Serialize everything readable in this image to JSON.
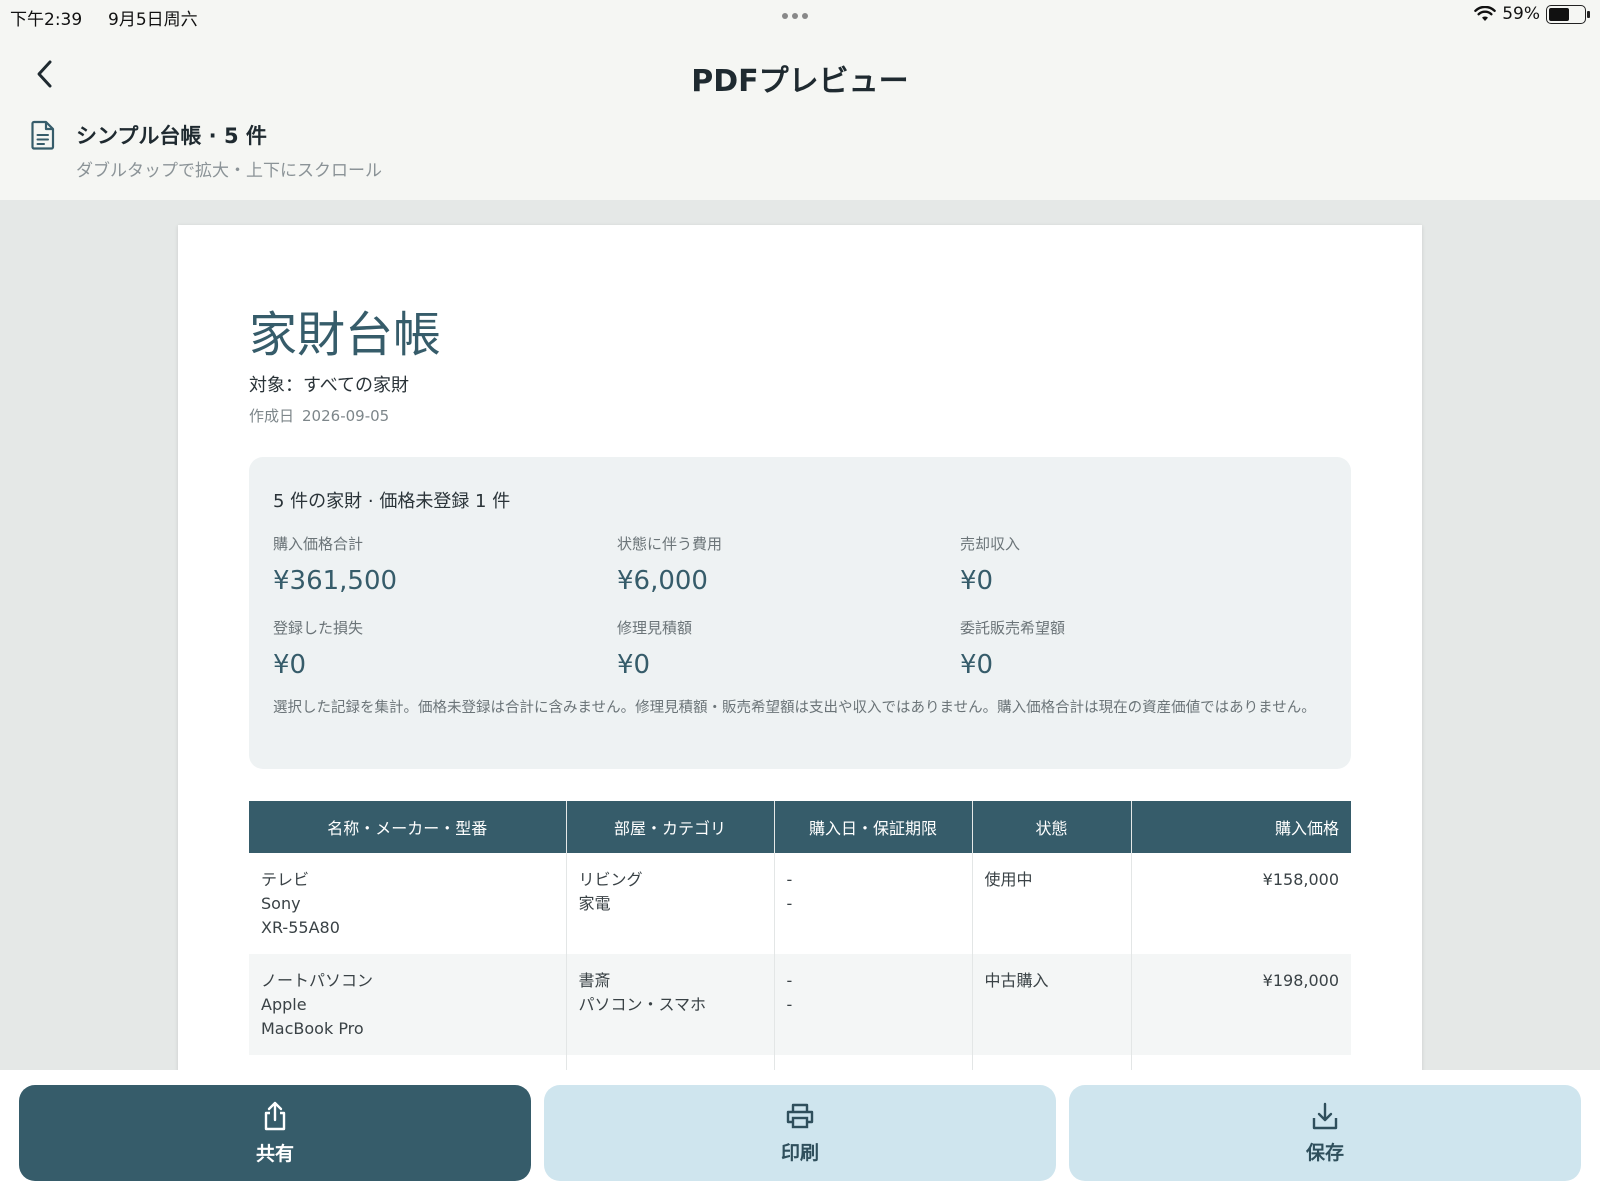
{
  "status_bar": {
    "time": "下午2:39",
    "date": "9月5日周六",
    "battery_text": "59%",
    "battery_level": 0.59
  },
  "nav": {
    "title": "PDFプレビュー"
  },
  "doc_info": {
    "title": "シンプル台帳 · 5 件",
    "subtitle": "ダブルタップで拡大・上下にスクロール"
  },
  "pdf": {
    "title": "家財台帳",
    "target": "対象：すべての家財",
    "created_label": "作成日",
    "created_date": "2026-09-05",
    "summary": {
      "headline": "5 件の家財 · 価格未登録 1 件",
      "metrics": [
        {
          "label": "購入価格合計",
          "value": "¥361,500"
        },
        {
          "label": "状態に伴う費用",
          "value": "¥6,000"
        },
        {
          "label": "売却収入",
          "value": "¥0"
        },
        {
          "label": "登録した損失",
          "value": "¥0"
        },
        {
          "label": "修理見積額",
          "value": "¥0"
        },
        {
          "label": "委託販売希望額",
          "value": "¥0"
        }
      ],
      "note": "選択した記録を集計。価格未登録は合計に含みません。修理見積額・販売希望額は支出や収入ではありません。購入価格合計は現在の資産価値ではありません。"
    },
    "table": {
      "headers": [
        "名称・メーカー・型番",
        "部屋・カテゴリ",
        "購入日・保証期限",
        "状態",
        "購入価格"
      ],
      "rows": [
        {
          "name": "テレビ",
          "maker": "Sony",
          "model": "XR-55A80",
          "room": "リビング",
          "category": "家電",
          "purchase_date": "-",
          "warranty": "-",
          "status": "使用中",
          "price": "¥158,000"
        },
        {
          "name": "ノートパソコン",
          "maker": "Apple",
          "model": "MacBook Pro",
          "room": "書斎",
          "category": "パソコン・スマホ",
          "purchase_date": "-",
          "warranty": "-",
          "status": "中古購入",
          "price": "¥198,000"
        }
      ]
    }
  },
  "actions": {
    "share": "共有",
    "print": "印刷",
    "save": "保存"
  },
  "colors": {
    "accent": "#365c6a",
    "secondary_button": "#cfe5ee"
  }
}
